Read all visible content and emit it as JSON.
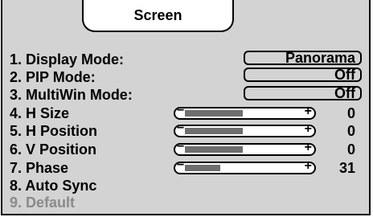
{
  "menu": {
    "title": "Screen",
    "items": [
      {
        "label": "1. Display Mode:",
        "value": "Panorama"
      },
      {
        "label": "2. PIP Mode:",
        "value": "Off"
      },
      {
        "label": "3. MultiWin Mode:",
        "value": "Off"
      },
      {
        "label": "4. H Size",
        "value": "0",
        "level": 0.5
      },
      {
        "label": "5. H Position",
        "value": "0",
        "level": 0.5
      },
      {
        "label": "6. V Position",
        "value": "0",
        "level": 0.5
      },
      {
        "label": "7. Phase",
        "value": "31",
        "level": 0.31
      },
      {
        "label": "8. Auto Sync"
      },
      {
        "label": "9. Default",
        "disabled": true
      }
    ],
    "slider_minus": "−",
    "slider_plus": "+"
  },
  "colors": {
    "panel_bg": "#d3d3d3",
    "slider_fill": "#6e6e6e",
    "disabled_text": "#8a8a8a"
  }
}
